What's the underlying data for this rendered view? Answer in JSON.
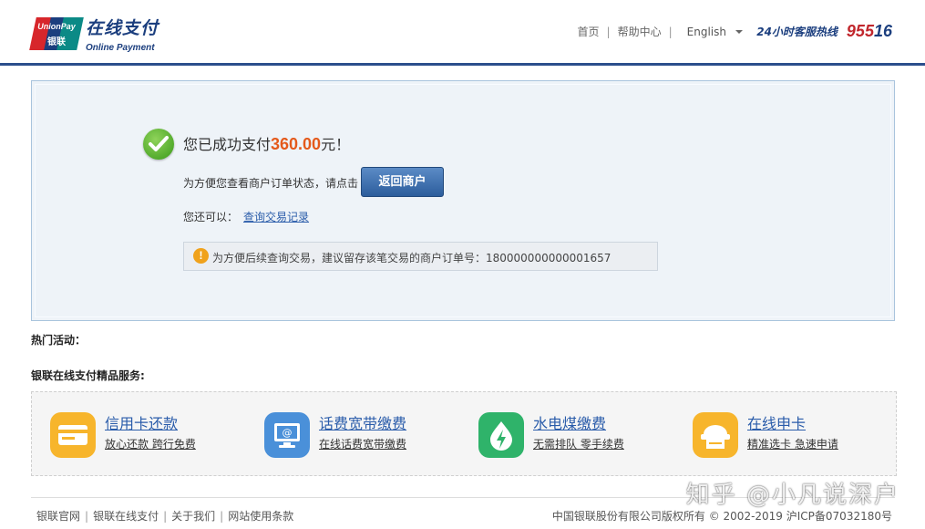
{
  "header": {
    "logo_brand_text": "UnionPay",
    "logo_brand_cn": "银联",
    "logo_title": "在线支付",
    "logo_subtitle": "Online Payment",
    "nav": {
      "home": "首页",
      "help": "帮助中心",
      "separator": "|",
      "language": "English"
    },
    "hotline_label": "24小时客服热线",
    "hotline_number_a": "955",
    "hotline_number_b": "16"
  },
  "success": {
    "prefix": "您已成功支付",
    "amount": "360.00",
    "suffix": "元！",
    "tip": "为方便您查看商户订单状态，请点击",
    "return_button": "返回商户",
    "also_label": "您还可以：",
    "query_link": "查询交易记录",
    "order_note": "为方便后续查询交易，建议留存该笔交易的商户订单号：180000000000001657",
    "warn_glyph": "!"
  },
  "sections": {
    "hot_activities": "热门活动：",
    "premium_services": "银联在线支付精品服务:"
  },
  "services": [
    {
      "title": "信用卡还款",
      "subtitle": "放心还款 跨行免费",
      "icon": "credit-card-icon",
      "color": "#f7b52c"
    },
    {
      "title": "话费宽带缴费",
      "subtitle": "在线话费宽带缴费",
      "icon": "computer-icon",
      "color": "#4a90d9"
    },
    {
      "title": "水电煤缴费",
      "subtitle": "无需排队 零手续费",
      "icon": "lightning-drop-icon",
      "color": "#2fb36a"
    },
    {
      "title": "在线申卡",
      "subtitle": "精准选卡 急速申请",
      "icon": "card-printer-icon",
      "color": "#f7b52c"
    }
  ],
  "footer": {
    "links": [
      "银联官网",
      "银联在线支付",
      "关于我们",
      "网站使用条款"
    ],
    "separator": "|",
    "copyright": "中国银联股份有限公司版权所有 © 2002-2019  沪ICP备07032180号"
  },
  "watermark": "知乎 @小凡说深户"
}
